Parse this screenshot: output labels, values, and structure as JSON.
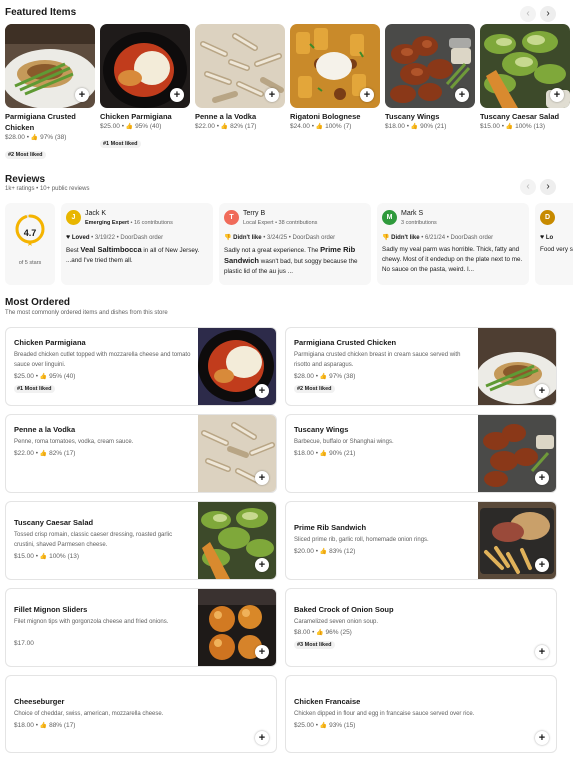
{
  "featured": {
    "title": "Featured Items",
    "items": [
      {
        "name": "Parmigiana Crusted Chicken",
        "price": "$28.00",
        "rating": "97% (38)",
        "badge": "#2 Most liked"
      },
      {
        "name": "Chicken Parmigiana",
        "price": "$25.00",
        "rating": "95% (40)",
        "badge": "#1 Most liked"
      },
      {
        "name": "Penne a la Vodka",
        "price": "$22.00",
        "rating": "82% (17)",
        "badge": ""
      },
      {
        "name": "Rigatoni Bolognese",
        "price": "$24.00",
        "rating": "100% (7)",
        "badge": ""
      },
      {
        "name": "Tuscany Wings",
        "price": "$18.00",
        "rating": "90% (21)",
        "badge": ""
      },
      {
        "name": "Tuscany Caesar Salad",
        "price": "$15.00",
        "rating": "100% (13)",
        "badge": ""
      }
    ]
  },
  "reviews": {
    "title": "Reviews",
    "subtitle": "1k+ ratings • 10+ public reviews",
    "score": "4.7",
    "score_caption": "of 5 stars",
    "score_fraction": 0.94,
    "items": [
      {
        "initial": "J",
        "color": "#e8b600",
        "name": "Jack K",
        "badge": "Emerging Expert",
        "contrib": " • 16 contributions",
        "verdict": "Loved",
        "verdict_icon": "heart-icon",
        "date": " • 3/19/22 • DoorDash order",
        "pre": "Best ",
        "highlight": "Veal Saltimbocca",
        "post": " in all of New Jersey.  ...and I've tried them all."
      },
      {
        "initial": "T",
        "color": "#f06b5a",
        "name": "Terry B",
        "badge": "",
        "contrib": "Local Expert • 38 contributions",
        "verdict": "Didn't like",
        "verdict_icon": "thumbs-down-icon",
        "date": " • 3/24/25 • DoorDash order",
        "pre": "Sadly not a great experience. The ",
        "highlight": "Prime Rib Sandwich",
        "post": " wasn't bad, but soggy because the plastic lid of the au jus ..."
      },
      {
        "initial": "M",
        "color": "#2f9a3c",
        "name": "Mark S",
        "badge": "",
        "contrib": "3 contributions",
        "verdict": "Didn't like",
        "verdict_icon": "thumbs-down-icon",
        "date": " • 6/21/24 • DoorDash order",
        "pre": "Sadly my veal parm was horrible. Thick, fatty and chewy. Most of it endedup on the plate next to me. No sauce on the pasta, weird. I...",
        "highlight": "",
        "post": ""
      },
      {
        "initial": "D",
        "color": "#c78a00",
        "name": "",
        "badge": "",
        "contrib": "",
        "verdict": "Lo",
        "verdict_icon": "heart-icon",
        "date": "",
        "pre": "Food very s",
        "highlight": "",
        "post": ""
      }
    ]
  },
  "most_ordered": {
    "title": "Most Ordered",
    "subtitle": "The most commonly ordered items and dishes from this store",
    "items": [
      {
        "name": "Chicken Parmigiana",
        "desc": "Breaded chicken cutlet topped with mozzarella cheese and tomato sauce over linguini.",
        "price": "$25.00",
        "rating": "95% (40)",
        "badge": "#1 Most liked",
        "has_image": true
      },
      {
        "name": "Parmigiana Crusted Chicken",
        "desc": "Parmigiana crusted chicken breast in cream sauce served with risotto and asparagus.",
        "price": "$28.00",
        "rating": "97% (38)",
        "badge": "#2 Most liked",
        "has_image": true
      },
      {
        "name": "Penne a la Vodka",
        "desc": "Penne, roma tomatoes, vodka, cream sauce.",
        "price": "$22.00",
        "rating": "82% (17)",
        "badge": "",
        "has_image": true
      },
      {
        "name": "Tuscany Wings",
        "desc": "Barbecue, buffalo or Shanghai wings.",
        "price": "$18.00",
        "rating": "90% (21)",
        "badge": "",
        "has_image": true
      },
      {
        "name": "Tuscany Caesar Salad",
        "desc": "Tossed crisp romain, classic caeser dressing, roasted garlic crustini, shaved Parmesen cheese.",
        "price": "$15.00",
        "rating": "100% (13)",
        "badge": "",
        "has_image": true
      },
      {
        "name": "Prime Rib Sandwich",
        "desc": "Sliced prime rib, garlic roll, homemade onion rings.",
        "price": "$20.00",
        "rating": "83% (12)",
        "badge": "",
        "has_image": true
      },
      {
        "name": "Fillet Mignon Sliders",
        "desc": "Filet mignon tips with gorgonzola cheese and fried onions.",
        "price": "$17.00",
        "rating": "",
        "badge": "",
        "has_image": true
      },
      {
        "name": "Baked Crock of Onion Soup",
        "desc": "Caramelized seven onion soup.",
        "price": "$8.00",
        "rating": "96% (25)",
        "badge": "#3 Most liked",
        "has_image": false
      },
      {
        "name": "Cheeseburger",
        "desc": "Choice of cheddar, swiss, american, mozzarella cheese.",
        "price": "$18.00",
        "rating": "88% (17)",
        "badge": "",
        "has_image": false
      },
      {
        "name": "Chicken Francaise",
        "desc": "Chicken dipped in flour and egg in francaise sauce served over rice.",
        "price": "$25.00",
        "rating": "93% (15)",
        "badge": "",
        "has_image": false
      }
    ]
  },
  "ui": {
    "prev": "‹",
    "next": "›",
    "plus": "+",
    "thumb": "👍",
    "dot": " • ",
    "heart": "♥",
    "thumbs_down": "👎",
    "star": "★"
  }
}
